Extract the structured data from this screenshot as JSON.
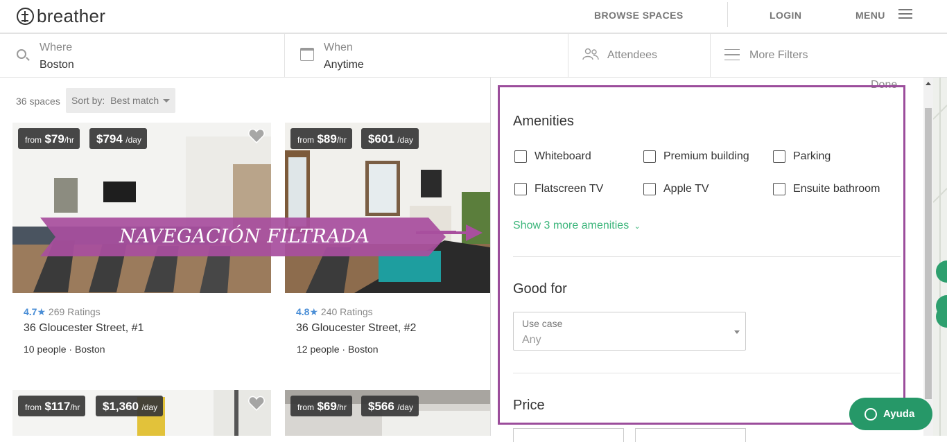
{
  "header": {
    "logo_text": "breather",
    "browse_label": "BROWSE SPACES",
    "login_label": "LOGIN",
    "menu_label": "MENU"
  },
  "filters": {
    "where_label": "Where",
    "where_value": "Boston",
    "when_label": "When",
    "when_value": "Anytime",
    "attendees_label": "Attendees",
    "more_filters_label": "More Filters"
  },
  "results": {
    "count": "36 spaces",
    "sort_label": "Sort by:",
    "sort_value": "Best match"
  },
  "cards": [
    {
      "from": "from",
      "hourly": "$79",
      "hr_unit": "/hr",
      "daily": "$794",
      "day_unit": "/day",
      "rating": "4.7",
      "ratings_count": "269 Ratings",
      "title": "36 Gloucester Street, #1",
      "people": "10 people",
      "city": "Boston"
    },
    {
      "from": "from",
      "hourly": "$89",
      "hr_unit": "/hr",
      "daily": "$601",
      "day_unit": "/day",
      "rating": "4.8",
      "ratings_count": "240 Ratings",
      "title": "36 Gloucester Street, #2",
      "people": "12 people",
      "city": "Boston"
    },
    {
      "from": "from",
      "hourly": "$117",
      "hr_unit": "/hr",
      "daily": "$1,360",
      "day_unit": "/day"
    },
    {
      "from": "from",
      "hourly": "$69",
      "hr_unit": "/hr",
      "daily": "$566",
      "day_unit": "/day"
    }
  ],
  "panel": {
    "done_label": "Done",
    "amenities_title": "Amenities",
    "amenities": [
      "Whiteboard",
      "Premium building",
      "Parking",
      "Flatscreen TV",
      "Apple TV",
      "Ensuite bathroom"
    ],
    "show_more": "Show 3 more amenities",
    "good_for_title": "Good for",
    "use_case_label": "Use case",
    "use_case_value": "Any",
    "price_title": "Price"
  },
  "annotation": {
    "banner_text": "NAVEGACIÓN FILTRADA"
  },
  "chat": {
    "label": "Ayuda"
  },
  "colors": {
    "accent_green": "#3bb57a",
    "chat_green": "#269868",
    "rating_blue": "#4a8ed6",
    "annotation_purple": "#9b4d9b"
  }
}
